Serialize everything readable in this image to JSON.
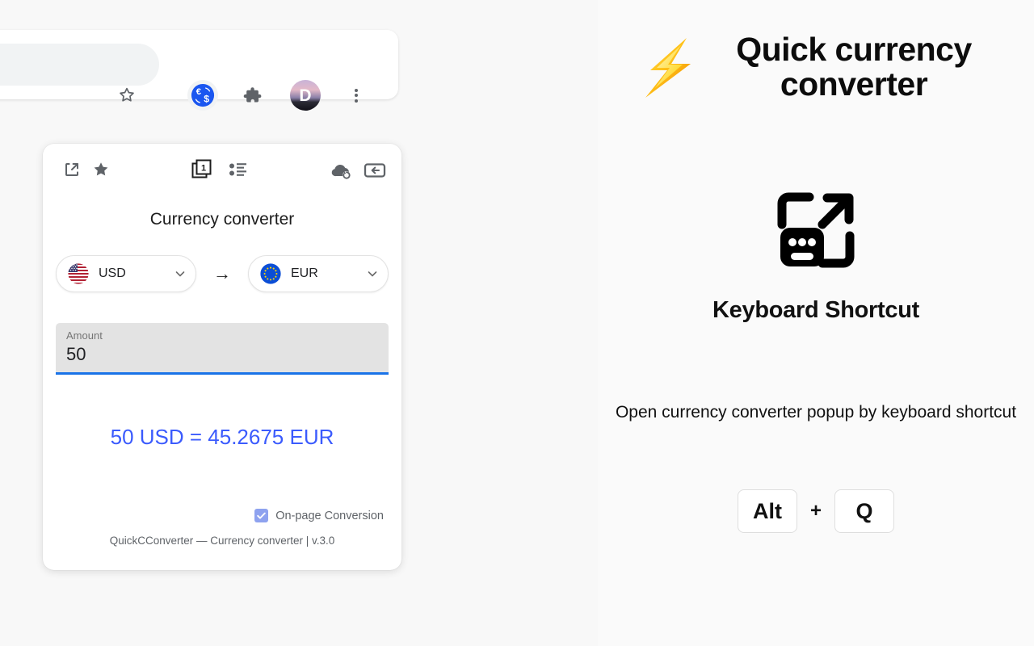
{
  "browser": {
    "omnibox_value": "",
    "icons": [
      {
        "name": "star-bookmark-icon",
        "label": "Bookmark this tab"
      },
      {
        "name": "currency-extension-icon",
        "label": "Quick currency converter"
      },
      {
        "name": "puzzle-extensions-icon",
        "label": "Extensions"
      },
      {
        "name": "profile-avatar",
        "label": "D"
      },
      {
        "name": "chrome-menu-icon",
        "label": "Customize and control"
      }
    ],
    "avatar_initial": "D"
  },
  "popup": {
    "title": "Currency converter",
    "toolbar": [
      {
        "name": "open-in-new-icon",
        "label": "Open in new window"
      },
      {
        "name": "favorite-star-icon",
        "label": "Favorites"
      },
      {
        "name": "multi-convert-icon",
        "label": "1"
      },
      {
        "name": "list-icon",
        "label": "Currency list"
      },
      {
        "name": "cloud-sync-icon",
        "label": "Sync rates"
      },
      {
        "name": "collapse-left-icon",
        "label": "Collapse"
      }
    ],
    "from_currency": {
      "code": "USD",
      "flag": "us-flag-icon"
    },
    "to_currency": {
      "code": "EUR",
      "flag": "eu-flag-icon"
    },
    "direction_arrow": "→",
    "amount": {
      "label": "Amount",
      "value": "50"
    },
    "result": "50 USD = 45.2675 EUR",
    "onpage_conversion": {
      "label": "On-page Conversion",
      "checked": true,
      "check_glyph": "✓"
    },
    "footer": "QuickCConverter — Currency converter | v.3.0"
  },
  "promo": {
    "brand_title": "Quick currency converter",
    "bolt_icon": "lightning-bolt-icon",
    "feature_icon": "keyboard-shortcut-popup-icon",
    "feature_heading": "Keyboard Shortcut",
    "feature_description": "Open currency converter popup by keyboard shortcut",
    "keys": [
      "Alt",
      "Q"
    ],
    "key_separator": "+"
  },
  "colors": {
    "accent_blue": "#3b5bfd",
    "field_underline": "#1a73e8",
    "checkbox": "#8ea2ef",
    "page_bg": "#fafafa"
  }
}
